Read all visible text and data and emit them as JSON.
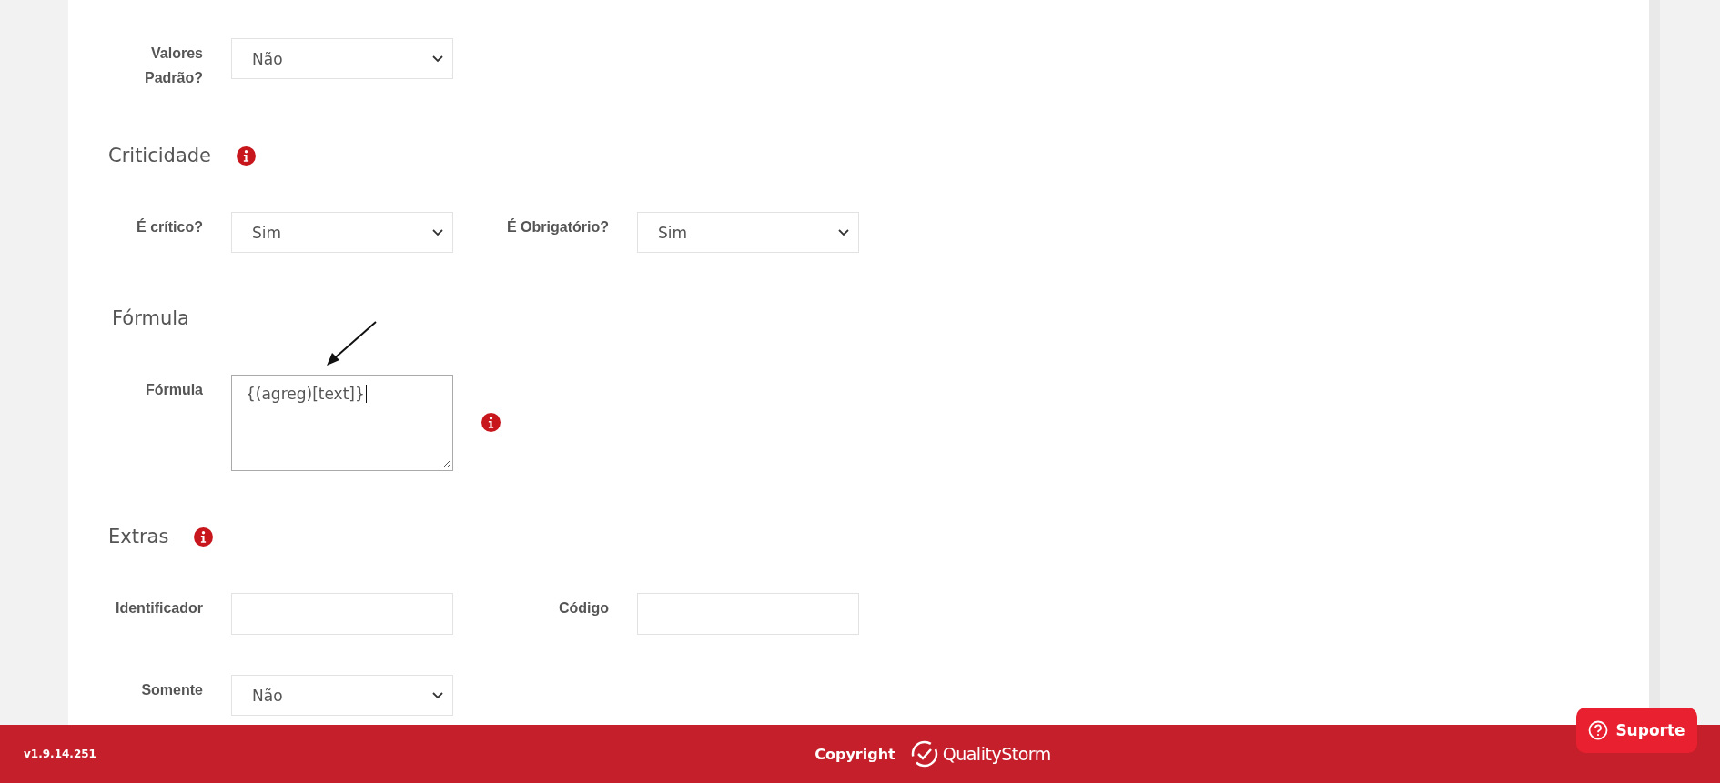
{
  "sections": [
    {
      "kind": "fields",
      "rows": [
        [
          {
            "label": "Valores Padrão?",
            "kind": "select",
            "value": "Não"
          }
        ]
      ]
    },
    {
      "kind": "heading",
      "title": "Criticidade",
      "info": true
    },
    {
      "kind": "fields",
      "rows": [
        [
          {
            "label": "É crítico?",
            "kind": "select",
            "value": "Sim"
          },
          {
            "label": "É Obrigatório?",
            "kind": "select",
            "value": "Sim"
          }
        ]
      ]
    },
    {
      "kind": "heading",
      "title": "Fórmula",
      "info": false
    },
    {
      "kind": "formula",
      "label": "Fórmula",
      "value": "{(agreg)[text]}",
      "info": true
    },
    {
      "kind": "heading",
      "title": "Extras",
      "info": true
    },
    {
      "kind": "fields",
      "rows": [
        [
          {
            "label": "Identificador",
            "kind": "input"
          },
          {
            "label": "Código",
            "kind": "input"
          }
        ],
        [
          {
            "label": "Somente",
            "kind": "select",
            "value": "Não"
          }
        ]
      ]
    }
  ],
  "footer": {
    "version": "v1.9.14.251",
    "copyright": "Copyright",
    "brand": "QualityStorm"
  },
  "support_button": {
    "label": "Suporte"
  }
}
